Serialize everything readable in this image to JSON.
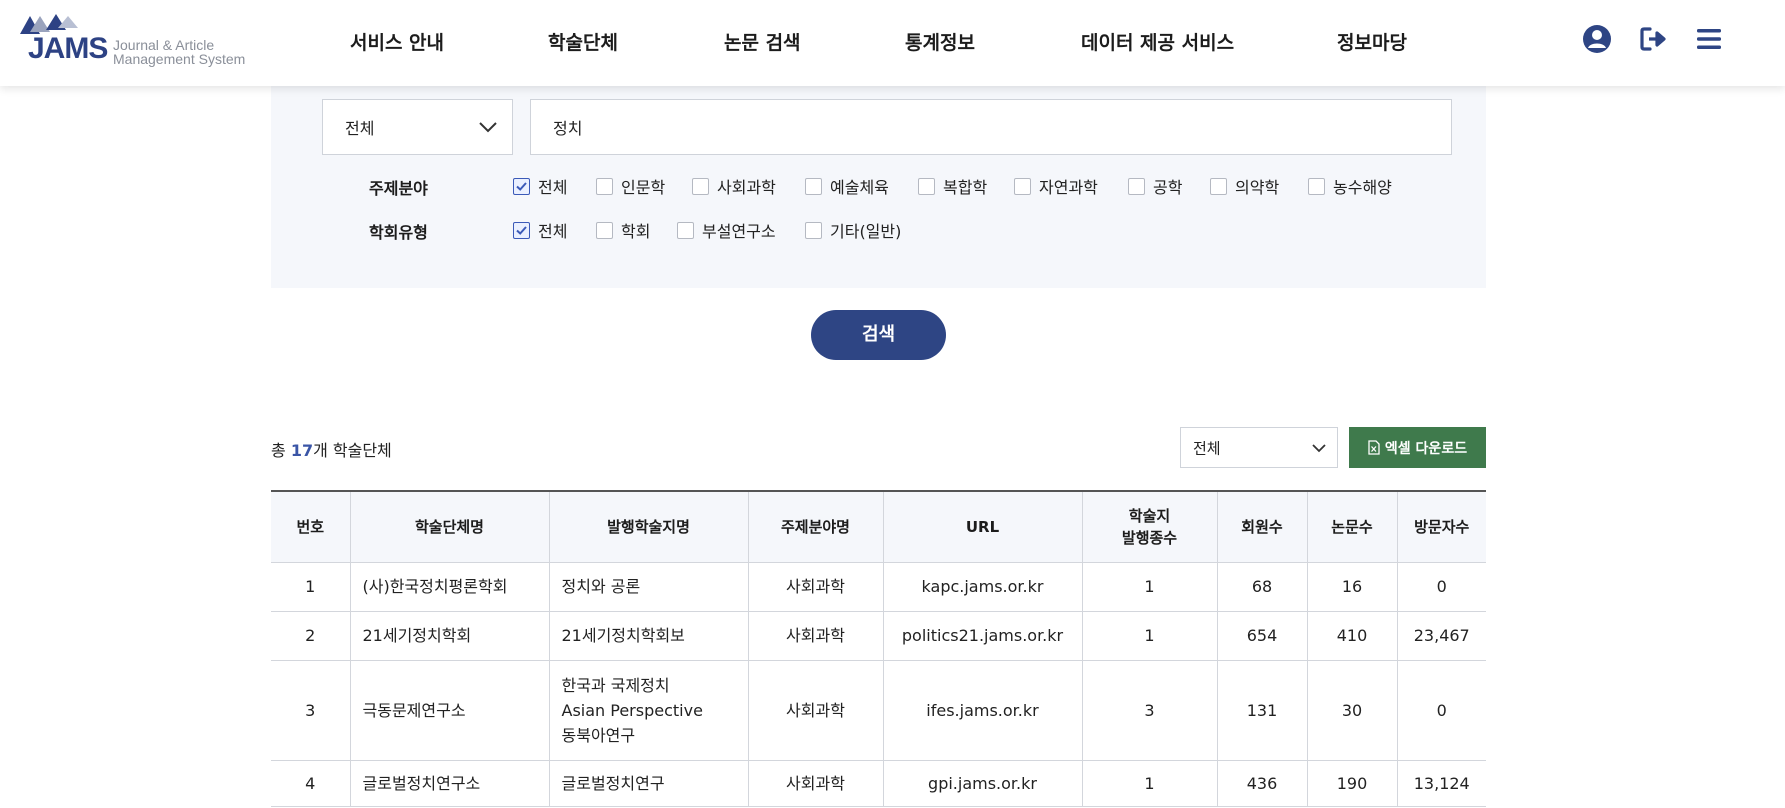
{
  "header": {
    "logo": {
      "name": "JAMS",
      "tagline_line1": "Journal & Article",
      "tagline_line2": "Management System"
    },
    "nav": [
      "서비스 안내",
      "학술단체",
      "논문 검색",
      "통계정보",
      "데이터 제공 서비스",
      "정보마당"
    ],
    "icons": [
      "user-icon",
      "logout-icon",
      "menu-icon"
    ]
  },
  "filters": {
    "scope_select": "전체",
    "search_value": "정치",
    "subject_label": "주제분야",
    "subject_options": [
      {
        "label": "전체",
        "checked": true
      },
      {
        "label": "인문학",
        "checked": false
      },
      {
        "label": "사회과학",
        "checked": false
      },
      {
        "label": "예술체육",
        "checked": false
      },
      {
        "label": "복합학",
        "checked": false
      },
      {
        "label": "자연과학",
        "checked": false
      },
      {
        "label": "공학",
        "checked": false
      },
      {
        "label": "의약학",
        "checked": false
      },
      {
        "label": "농수해양",
        "checked": false
      }
    ],
    "type_label": "학회유형",
    "type_options": [
      {
        "label": "전체",
        "checked": true
      },
      {
        "label": "학회",
        "checked": false
      },
      {
        "label": "부설연구소",
        "checked": false
      },
      {
        "label": "기타(일반)",
        "checked": false
      }
    ],
    "search_button": "검색"
  },
  "results": {
    "total_prefix": "총 ",
    "total_count": "17",
    "total_suffix": "개 학술단체",
    "sort_select": "전체",
    "excel_button": "엑셀 다운로드"
  },
  "table": {
    "headers": [
      "번호",
      "학술단체명",
      "발행학술지명",
      "주제분야명",
      "URL",
      "학술지",
      "발행종수",
      "회원수",
      "논문수",
      "방문자수"
    ],
    "rows": [
      {
        "no": "1",
        "org": "(사)한국정치평론학회",
        "journals": [
          "정치와 공론"
        ],
        "field": "사회과학",
        "url": "kapc.jams.or.kr",
        "issues": "1",
        "members": "68",
        "papers": "16",
        "visitors": "0"
      },
      {
        "no": "2",
        "org": "21세기정치학회",
        "journals": [
          "21세기정치학회보"
        ],
        "field": "사회과학",
        "url": "politics21.jams.or.kr",
        "issues": "1",
        "members": "654",
        "papers": "410",
        "visitors": "23,467"
      },
      {
        "no": "3",
        "org": "극동문제연구소",
        "journals": [
          "한국과 국제정치",
          "Asian Perspective",
          "동북아연구"
        ],
        "field": "사회과학",
        "url": "ifes.jams.or.kr",
        "issues": "3",
        "members": "131",
        "papers": "30",
        "visitors": "0"
      },
      {
        "no": "4",
        "org": "글로벌정치연구소",
        "journals": [
          "글로벌정치연구"
        ],
        "field": "사회과학",
        "url": "gpi.jams.or.kr",
        "issues": "1",
        "members": "436",
        "papers": "190",
        "visitors": "13,124"
      }
    ]
  },
  "colors": {
    "brand": "#2e4584",
    "excel": "#3f7a4c",
    "panel_bg": "#f5f7fb",
    "accent_count": "#3a55a6"
  }
}
